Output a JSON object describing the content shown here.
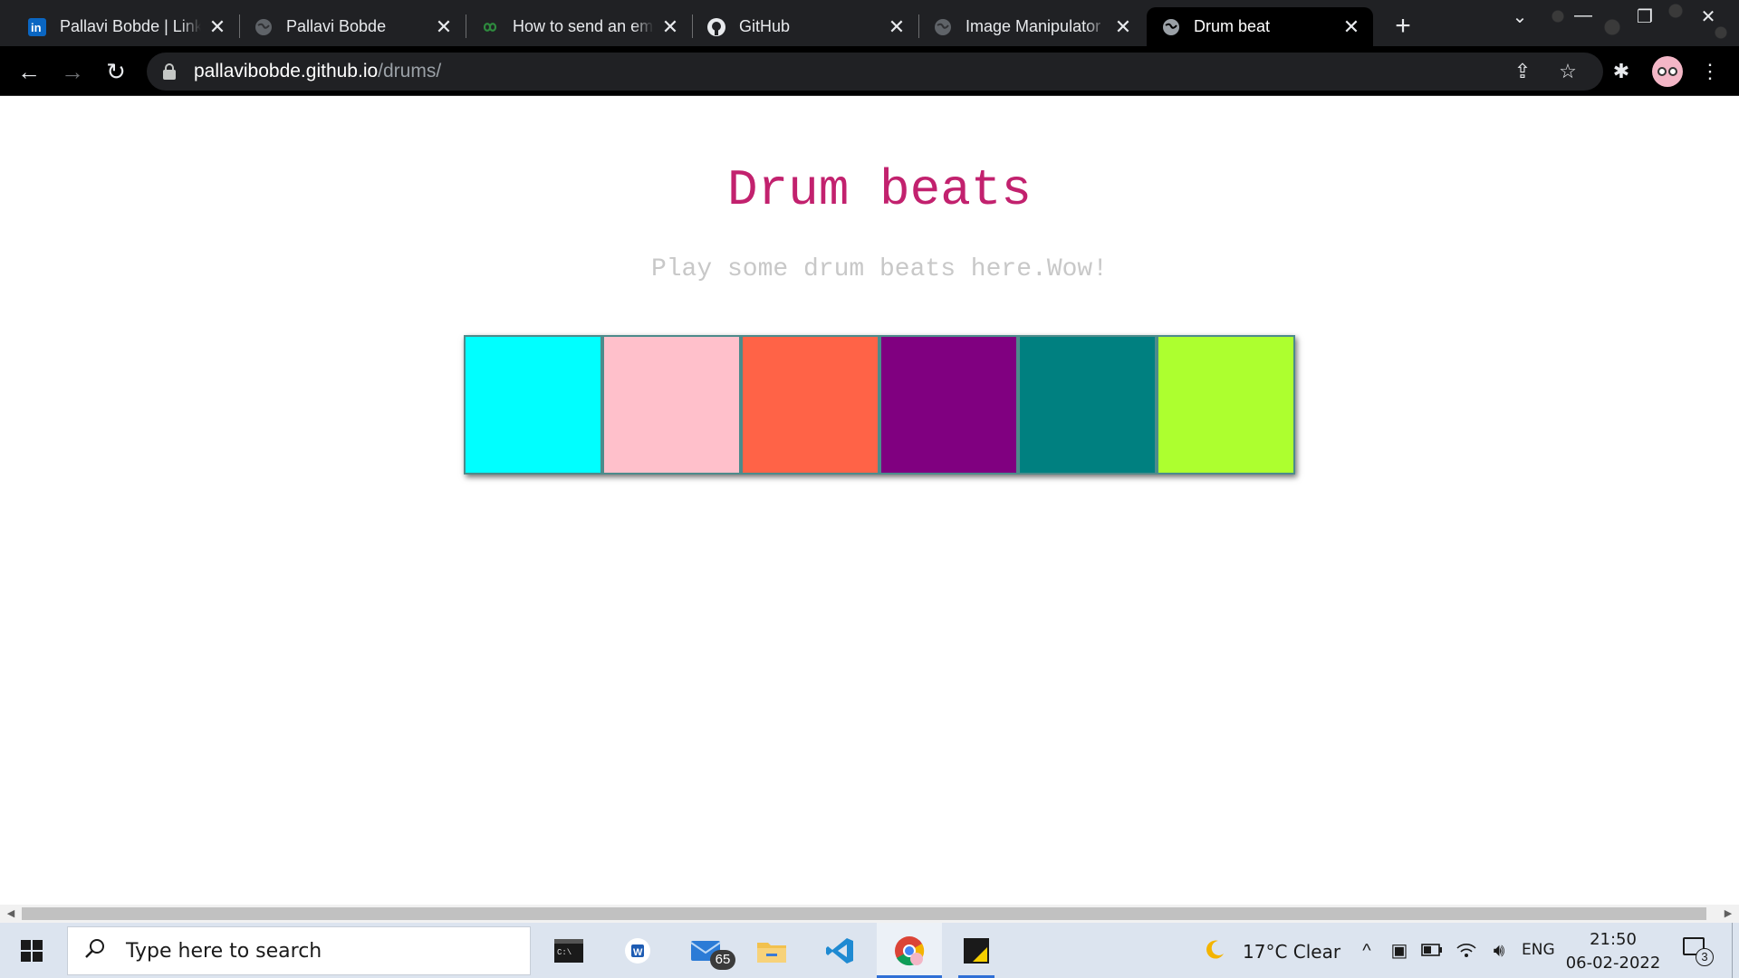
{
  "browser": {
    "tabs": [
      {
        "title": "Pallavi Bobde | LinkedIn",
        "favicon": "linkedin-icon",
        "active": false
      },
      {
        "title": "Pallavi Bobde",
        "favicon": "globe-icon",
        "active": false
      },
      {
        "title": "How to send an email",
        "favicon": "infinity-icon",
        "active": false
      },
      {
        "title": "GitHub",
        "favicon": "github-icon",
        "active": false
      },
      {
        "title": "Image Manipulator",
        "favicon": "globe-icon",
        "active": false
      },
      {
        "title": "Drum beat",
        "favicon": "globe-icon",
        "active": true
      }
    ],
    "url_host": "pallavibobde.github.io",
    "url_path": "/drums/"
  },
  "page": {
    "heading": "Drum beats",
    "subtitle": "Play some drum beats here.Wow!",
    "pads": [
      {
        "name": "drum-pad-1",
        "color": "#00ffff"
      },
      {
        "name": "drum-pad-2",
        "color": "#ffc0cb"
      },
      {
        "name": "drum-pad-3",
        "color": "#ff6347"
      },
      {
        "name": "drum-pad-4",
        "color": "#800080"
      },
      {
        "name": "drum-pad-5",
        "color": "#008080"
      },
      {
        "name": "drum-pad-6",
        "color": "#adff2f"
      }
    ],
    "heading_color": "#c2216e"
  },
  "taskbar": {
    "search_placeholder": "Type here to search",
    "mail_badge": "65",
    "weather": "17°C  Clear",
    "language": "ENG",
    "time": "21:50",
    "date": "06-02-2022",
    "notifications": "3"
  }
}
